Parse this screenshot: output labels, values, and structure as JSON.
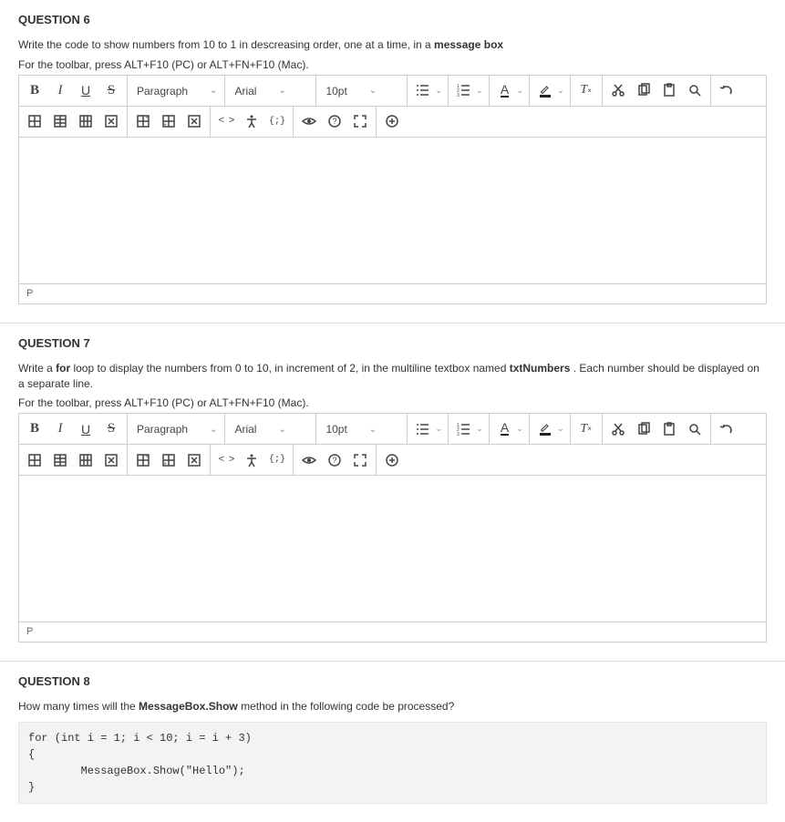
{
  "questions": [
    {
      "title": "QUESTION 6",
      "prompt_pre": "Write the code to show numbers from 10 to 1 in descreasing order, one at a time, in a ",
      "prompt_bold": "message box",
      "prompt_post": "",
      "help": "For the toolbar, press ALT+F10 (PC) or ALT+FN+F10 (Mac).",
      "status": "P"
    },
    {
      "title": "QUESTION 7",
      "prompt_pre": "Write a ",
      "prompt_bold": "for",
      "prompt_mid": " loop to display the numbers from 0 to 10, in increment of 2, in the multiline textbox named ",
      "prompt_bold2": "txtNumbers",
      "prompt_post": " . Each number should be displayed on a separate line.",
      "help": "For the toolbar, press ALT+F10 (PC) or ALT+FN+F10 (Mac).",
      "status": "P"
    },
    {
      "title": "QUESTION 8",
      "prompt_pre": "How many times will the ",
      "prompt_bold": "MessageBox.Show",
      "prompt_post": " method in the following code be processed?",
      "code": "for (int i = 1; i < 10; i = i + 3)\n{\n        MessageBox.Show(\"Hello\");\n}"
    }
  ],
  "toolbar": {
    "block_format": "Paragraph",
    "font_family": "Arial",
    "font_size": "10pt",
    "bold": "B",
    "italic": "I",
    "underline": "U",
    "strike": "S",
    "font_color_letter": "A",
    "code": "< >",
    "vars": "{;}"
  }
}
